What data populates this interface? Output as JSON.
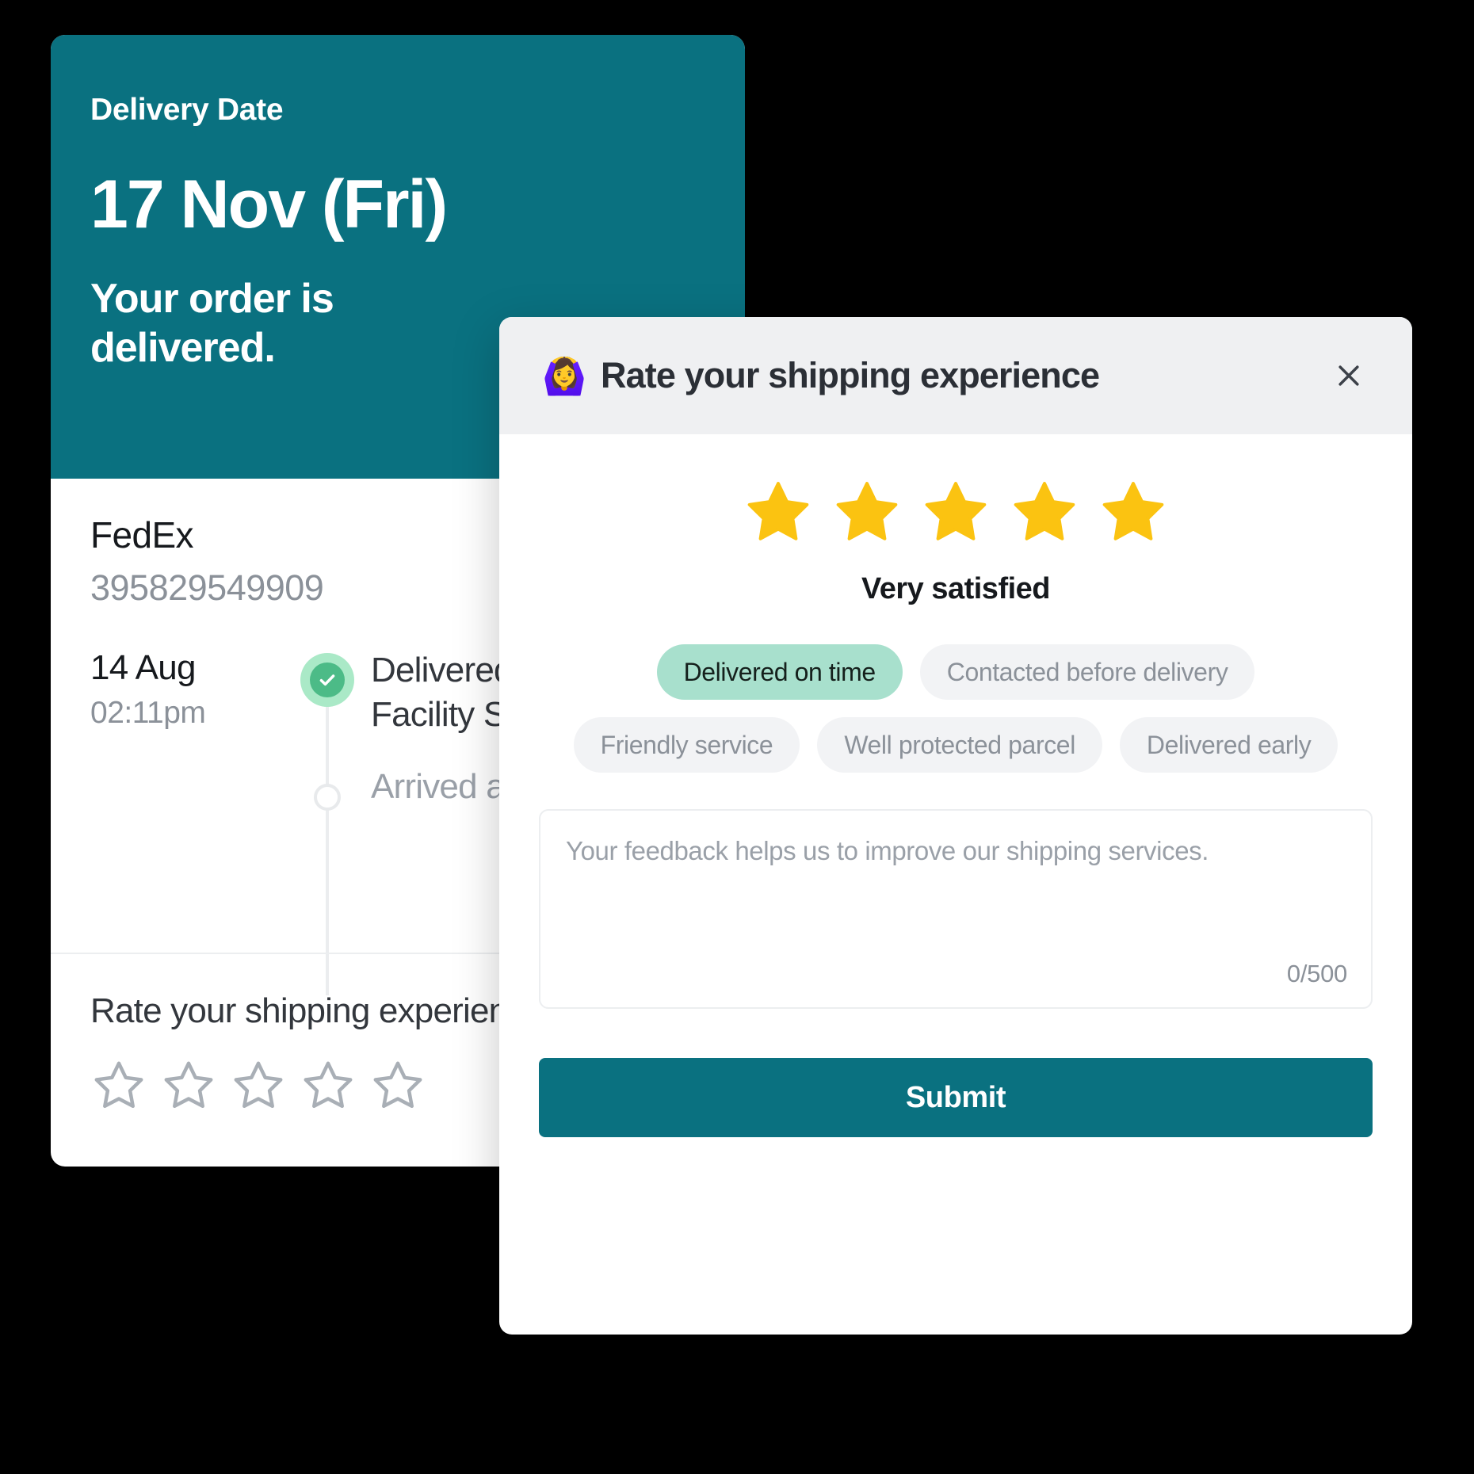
{
  "tracking_card": {
    "header": {
      "delivery_date_label": "Delivery Date",
      "delivery_date": "17 Nov (Fri)",
      "status_text": "Your order is delivered."
    },
    "carrier": "FedEx",
    "tracking_number": "395829549909",
    "timeline": [
      {
        "date": "14 Aug",
        "time": "02:11pm",
        "title": "Delivered FedEx L Facility Syracus",
        "state": "completed",
        "marker_icon": "check-icon"
      },
      {
        "date": "",
        "time": "",
        "title": "Arrived at location n",
        "state": "pending",
        "marker_icon": "circle-outline-icon"
      }
    ],
    "rate_section": {
      "label": "Rate your shipping experien",
      "stars_total": 5,
      "stars_filled": 0
    }
  },
  "modal": {
    "emoji": "🙆‍♀️",
    "emoji_name": "woman-gesturing-ok-emoji",
    "title": "Rate your shipping experience",
    "close_label": "×",
    "rating": {
      "stars_total": 5,
      "stars_filled": 5,
      "label": "Very satisfied"
    },
    "chips": [
      {
        "label": "Delivered on time",
        "selected": true
      },
      {
        "label": "Contacted before delivery",
        "selected": false
      },
      {
        "label": "Friendly service",
        "selected": false
      },
      {
        "label": "Well protected parcel",
        "selected": false
      },
      {
        "label": "Delivered early",
        "selected": false
      }
    ],
    "feedback": {
      "placeholder": "Your feedback helps us to improve our shipping services.",
      "value": "",
      "char_count": "0/500"
    },
    "submit_label": "Submit"
  },
  "colors": {
    "brand_teal": "#0a7180",
    "star_gold": "#FBC311",
    "chip_selected": "#a8e0cd",
    "chip_default": "#f2f3f5",
    "marker_green": "#4cbb87",
    "marker_green_halo": "#aae9c7",
    "modal_header_bg": "#eff0f2",
    "page_bg": "#000000"
  }
}
